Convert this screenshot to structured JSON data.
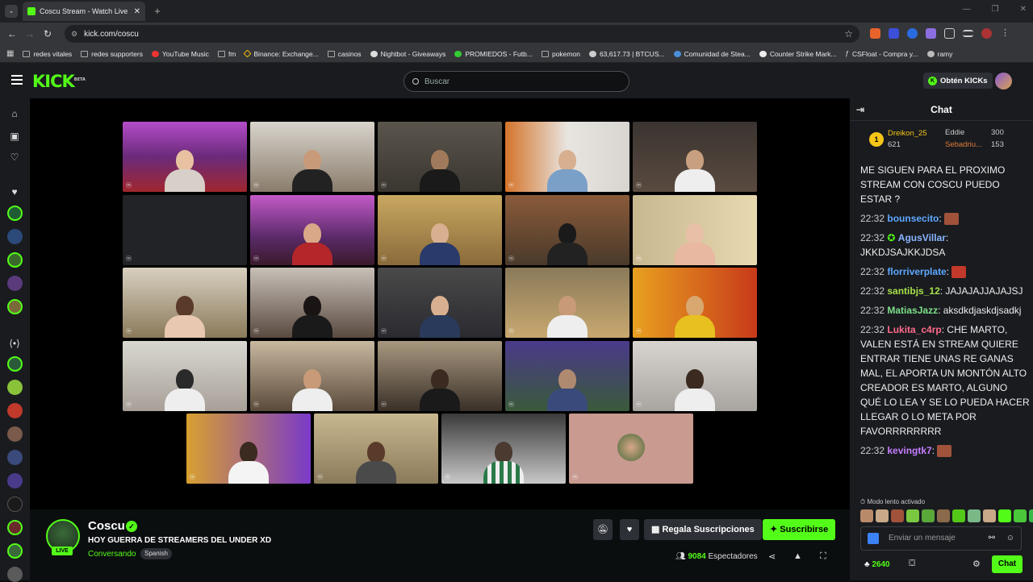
{
  "browser": {
    "tab_title": "Coscu Stream - Watch Live",
    "url": "kick.com/coscu",
    "bookmarks": [
      "redes vitales",
      "redes supporters",
      "YouTube Music",
      "fm",
      "Binance: Exchange...",
      "casinos",
      "Nightbot - Giveaways",
      "PROMIEDOS - Futb...",
      "pokemon",
      "63,617.73 | BTCUS...",
      "Comunidad de Stea...",
      "Counter Strike Mark...",
      "CSFloat - Compra y...",
      "ramy"
    ]
  },
  "header": {
    "logo": "KICK",
    "logo_badge": "BETA",
    "search_placeholder": "Buscar",
    "kicks_button": "Obtén KICKs"
  },
  "channel": {
    "name": "Coscu",
    "live_badge": "LIVE",
    "title": "HOY GUERRA DE STREAMERS DEL UNDER XD",
    "category": "Conversando",
    "language_tag": "Spanish",
    "gift_button": "Regala Suscripciones",
    "subscribe_button": "Suscribirse",
    "viewer_count": "9084",
    "viewer_label": "Espectadores"
  },
  "chat": {
    "header": "Chat",
    "leaderboard": {
      "first": {
        "name": "Dreikon_25",
        "value": "621",
        "rank": "1"
      },
      "second": {
        "name": "Eddie",
        "value": "300"
      },
      "third": {
        "name": "Sebadriu...",
        "value": "153"
      }
    },
    "first_message_text": "ME SIGUEN PARA EL PROXIMO STREAM CON COSCU PUEDO ESTAR ?",
    "messages": [
      {
        "time": "22:32",
        "user": "bounsecito",
        "text": "",
        "color": "#5fa8ff"
      },
      {
        "time": "22:32",
        "user": "AgusVillar",
        "text": "JKKDJSAJKKJDSA",
        "color": "#8ab4ff"
      },
      {
        "time": "22:32",
        "user": "florriverplate",
        "text": "",
        "color": "#5fa8ff"
      },
      {
        "time": "22:32",
        "user": "santibjs_12",
        "text": "JAJAJAJJAJAJSJ",
        "color": "#a8e04a"
      },
      {
        "time": "22:32",
        "user": "MatiasJazz",
        "text": "aksdkdjaskdjsadkj",
        "color": "#7ee08a"
      },
      {
        "time": "22:32",
        "user": "Lukita_c4rp",
        "text": "CHE MARTO, VALEN ESTÁ EN STREAM QUIERE ENTRAR TIENE UNAS RE GANAS MAL, EL APORTA UN MONTÓN ALTO CREADOR ES MARTO, ALGUNO QUÉ LO LEA Y SE LO PUEDA HACER LLEGAR O LO METa POR FAVORRRRRRRR",
        "color": "#ff6b8a"
      },
      {
        "time": "22:32",
        "user": "kevingtk7",
        "text": "",
        "color": "#c77dff"
      }
    ],
    "slow_mode": "Modo lento activado",
    "input_placeholder": "Enviar un mensaje",
    "points": "2640",
    "chat_button": "Chat"
  }
}
